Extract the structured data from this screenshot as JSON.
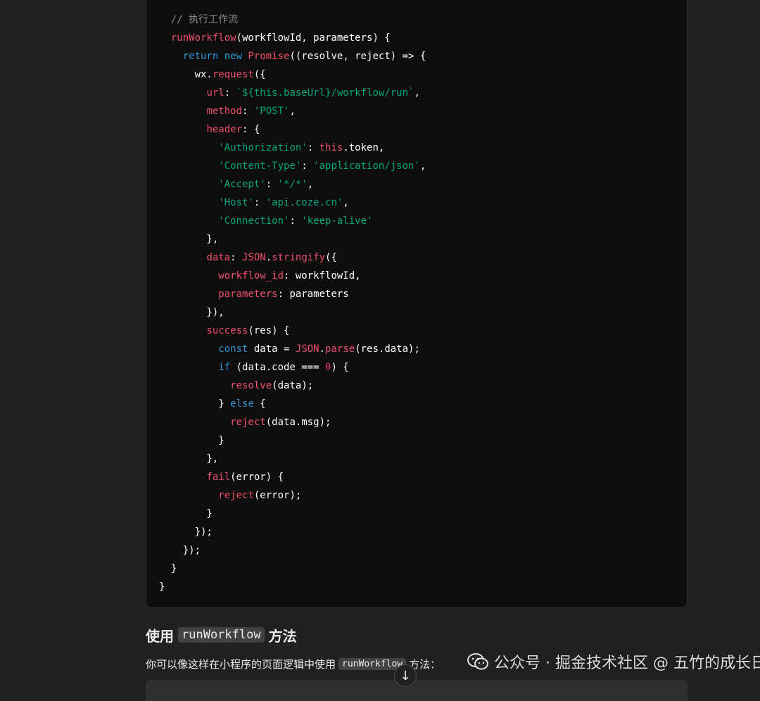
{
  "code_block": {
    "lines": [
      [
        {
          "t": "  "
        },
        {
          "t": "// 执行工作流",
          "c": "comment"
        }
      ],
      [
        {
          "t": "  "
        },
        {
          "t": "runWorkflow",
          "c": "fn"
        },
        {
          "t": "(workflowId, parameters) {"
        }
      ],
      [
        {
          "t": "    "
        },
        {
          "t": "return",
          "c": "kw"
        },
        {
          "t": " "
        },
        {
          "t": "new",
          "c": "kw"
        },
        {
          "t": " "
        },
        {
          "t": "Promise",
          "c": "fn"
        },
        {
          "t": "((resolve, reject) => {"
        }
      ],
      [
        {
          "t": "      wx."
        },
        {
          "t": "request",
          "c": "fn"
        },
        {
          "t": "({"
        }
      ],
      [
        {
          "t": "        "
        },
        {
          "t": "url",
          "c": "prop"
        },
        {
          "t": ": "
        },
        {
          "t": "`${this.baseUrl}/workflow/run`",
          "c": "str"
        },
        {
          "t": ","
        }
      ],
      [
        {
          "t": "        "
        },
        {
          "t": "method",
          "c": "prop"
        },
        {
          "t": ": "
        },
        {
          "t": "'POST'",
          "c": "str"
        },
        {
          "t": ","
        }
      ],
      [
        {
          "t": "        "
        },
        {
          "t": "header",
          "c": "prop"
        },
        {
          "t": ": {"
        }
      ],
      [
        {
          "t": "          "
        },
        {
          "t": "'Authorization'",
          "c": "str"
        },
        {
          "t": ": "
        },
        {
          "t": "this",
          "c": "fn"
        },
        {
          "t": ".token,"
        }
      ],
      [
        {
          "t": "          "
        },
        {
          "t": "'Content-Type'",
          "c": "str"
        },
        {
          "t": ": "
        },
        {
          "t": "'application/json'",
          "c": "str"
        },
        {
          "t": ","
        }
      ],
      [
        {
          "t": "          "
        },
        {
          "t": "'Accept'",
          "c": "str"
        },
        {
          "t": ": "
        },
        {
          "t": "'*/*'",
          "c": "str"
        },
        {
          "t": ","
        }
      ],
      [
        {
          "t": "          "
        },
        {
          "t": "'Host'",
          "c": "str"
        },
        {
          "t": ": "
        },
        {
          "t": "'api.coze.cn'",
          "c": "str"
        },
        {
          "t": ","
        }
      ],
      [
        {
          "t": "          "
        },
        {
          "t": "'Connection'",
          "c": "str"
        },
        {
          "t": ": "
        },
        {
          "t": "'keep-alive'",
          "c": "str"
        }
      ],
      [
        {
          "t": "        },"
        }
      ],
      [
        {
          "t": "        "
        },
        {
          "t": "data",
          "c": "prop"
        },
        {
          "t": ": "
        },
        {
          "t": "JSON",
          "c": "fn"
        },
        {
          "t": "."
        },
        {
          "t": "stringify",
          "c": "fn"
        },
        {
          "t": "({"
        }
      ],
      [
        {
          "t": "          "
        },
        {
          "t": "workflow_id",
          "c": "prop"
        },
        {
          "t": ": workflowId,"
        }
      ],
      [
        {
          "t": "          "
        },
        {
          "t": "parameters",
          "c": "prop"
        },
        {
          "t": ": parameters"
        }
      ],
      [
        {
          "t": "        }),"
        }
      ],
      [
        {
          "t": "        "
        },
        {
          "t": "success",
          "c": "fn"
        },
        {
          "t": "(res) {"
        }
      ],
      [
        {
          "t": "          "
        },
        {
          "t": "const",
          "c": "kw"
        },
        {
          "t": " data = "
        },
        {
          "t": "JSON",
          "c": "fn"
        },
        {
          "t": "."
        },
        {
          "t": "parse",
          "c": "fn"
        },
        {
          "t": "(res.data);"
        }
      ],
      [
        {
          "t": "          "
        },
        {
          "t": "if",
          "c": "kw"
        },
        {
          "t": " (data.code === "
        },
        {
          "t": "0",
          "c": "num"
        },
        {
          "t": ") {"
        }
      ],
      [
        {
          "t": "            "
        },
        {
          "t": "resolve",
          "c": "fn"
        },
        {
          "t": "(data);"
        }
      ],
      [
        {
          "t": "          } "
        },
        {
          "t": "else",
          "c": "kw"
        },
        {
          "t": " {"
        }
      ],
      [
        {
          "t": "            "
        },
        {
          "t": "reject",
          "c": "fn"
        },
        {
          "t": "(data.msg);"
        }
      ],
      [
        {
          "t": "          }"
        }
      ],
      [
        {
          "t": "        },"
        }
      ],
      [
        {
          "t": "        "
        },
        {
          "t": "fail",
          "c": "fn"
        },
        {
          "t": "(error) {"
        }
      ],
      [
        {
          "t": "          "
        },
        {
          "t": "reject",
          "c": "fn"
        },
        {
          "t": "(error);"
        }
      ],
      [
        {
          "t": "        }"
        }
      ],
      [
        {
          "t": "      });"
        }
      ],
      [
        {
          "t": "    });"
        }
      ],
      [
        {
          "t": "  }"
        }
      ],
      [
        {
          "t": "}"
        }
      ]
    ]
  },
  "section": {
    "heading_prefix": "使用",
    "heading_code": "runWorkflow",
    "heading_suffix": "方法",
    "paragraph_prefix": "你可以像这样在小程序的页面逻辑中使用",
    "paragraph_code": "runWorkflow",
    "paragraph_suffix": "方法："
  },
  "scroll_button": {
    "label": "↓",
    "icon": "arrow-down-icon"
  },
  "watermark": {
    "text": "公众号 · 掘金技术社区 @ 五竹的成长日记",
    "icon": "wechat-icon"
  },
  "colors": {
    "background": "#212121",
    "code_background": "#0d0d0d",
    "comment": "#8e8e8e",
    "function": "#ee4f6e",
    "keyword": "#2e95d3",
    "string": "#00a67d",
    "number": "#df3079"
  }
}
